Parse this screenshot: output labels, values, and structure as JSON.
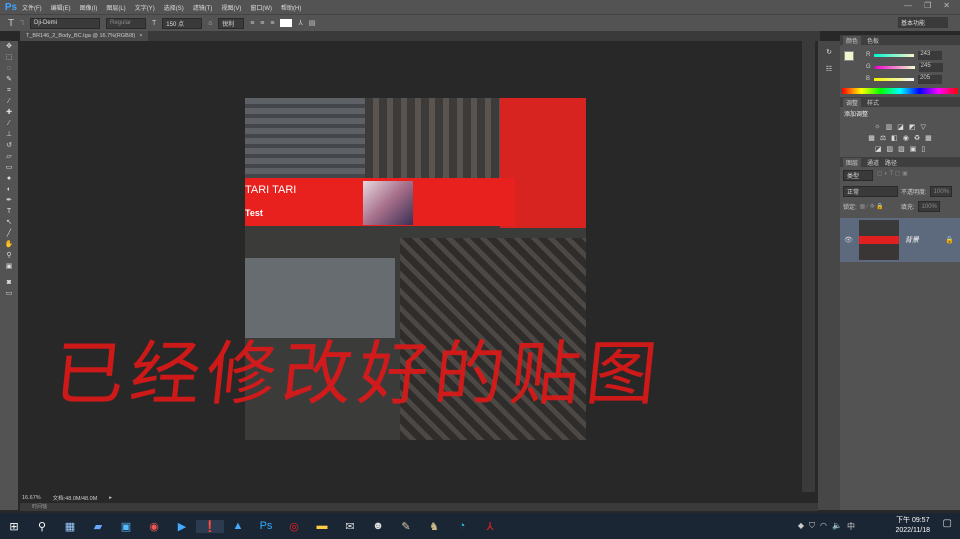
{
  "app": {
    "logo": "Ps"
  },
  "menu": [
    "文件(F)",
    "编辑(E)",
    "图像(I)",
    "图层(L)",
    "文字(Y)",
    "选择(S)",
    "滤镜(T)",
    "视图(V)",
    "窗口(W)",
    "帮助(H)"
  ],
  "options": {
    "font": "Dji-Demi",
    "style": "Regular",
    "size": "150 点",
    "antialias": "锐利",
    "workspace": "基本功能"
  },
  "document_tab": "T_BR146_2_Body_BC.tga @ 16.7%(RGB/8)",
  "canvas": {
    "title_text": "TARI TARI",
    "sub_text": "Test",
    "handwriting": "已经修改好的贴图"
  },
  "color_panel": {
    "tabs": [
      "颜色",
      "色板"
    ],
    "R": "243",
    "G": "245",
    "B": "205",
    "labels": [
      "R",
      "G",
      "B"
    ]
  },
  "adjust_panel": {
    "tabs": [
      "调整",
      "样式"
    ],
    "heading": "添加调整"
  },
  "layers_panel": {
    "tabs": [
      "图层",
      "通道",
      "路径"
    ],
    "filter": "类型",
    "blend": "正常",
    "opacity_label": "不透明度:",
    "opacity": "100%",
    "lock_label": "锁定:",
    "fill_label": "填充:",
    "fill": "100%",
    "layer_name": "背景"
  },
  "status": {
    "zoom": "16.67%",
    "doc": "文档:48.0M/48.0M",
    "timeline": "时间轴"
  },
  "taskbar": {
    "time": "下午 09:57",
    "date": "2022/11/18",
    "ime": "中"
  }
}
